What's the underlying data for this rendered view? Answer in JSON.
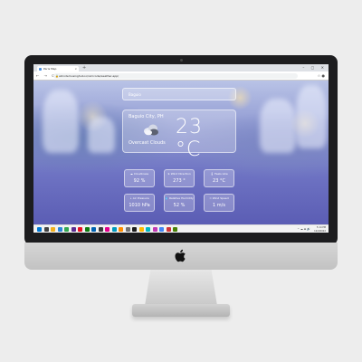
{
  "browser": {
    "tab_title": "Paris Map",
    "new_tab_symbol": "+",
    "tab_close_symbol": "×",
    "window_controls": "– ▢ ✕",
    "nav_buttons": "← → ⟳",
    "url": "allcodemusinghub.io/ramcode/weather-app/",
    "lock_symbol": "🔒",
    "extensions": "☆ ●"
  },
  "app": {
    "search": {
      "value": "Baguio"
    },
    "current": {
      "city": "Baguio City, PH",
      "temperature": "23 °C",
      "condition": "Overcast Clouds",
      "icon": "cloud-icon"
    },
    "stats": [
      {
        "label": "☁ Cloudiness",
        "value": "92 %"
      },
      {
        "label": "➤ Wind Direction",
        "value": "273 °"
      },
      {
        "label": "🌡 Feels Like",
        "value": "23 °C"
      },
      {
        "label": "⇣ Air Pressure",
        "value": "1010 hPa"
      },
      {
        "label": "💧 Relative Humidity",
        "value": "52 %"
      },
      {
        "label": "≈ Wind Speed",
        "value": "1 m/s"
      }
    ]
  },
  "taskbar": {
    "tray": "^ ☁ ⊞ 🔊",
    "time": "5:14 PM",
    "date": "12/4/2022",
    "icon_colors": [
      "#0078d4",
      "#444444",
      "#f2b01e",
      "#2b88d8",
      "#34a853",
      "#5c2d91",
      "#e81123",
      "#107c10",
      "#0063b1",
      "#3b3b3b",
      "#e3008c",
      "#0099bc",
      "#ff8c00",
      "#737373",
      "#1e1e1e",
      "#ffb900",
      "#00b7c3",
      "#c239b3",
      "#4285f4",
      "#d13438",
      "#498205"
    ]
  },
  "colors": {
    "accent": "#6e73c3",
    "card_text": "#ffffff"
  }
}
